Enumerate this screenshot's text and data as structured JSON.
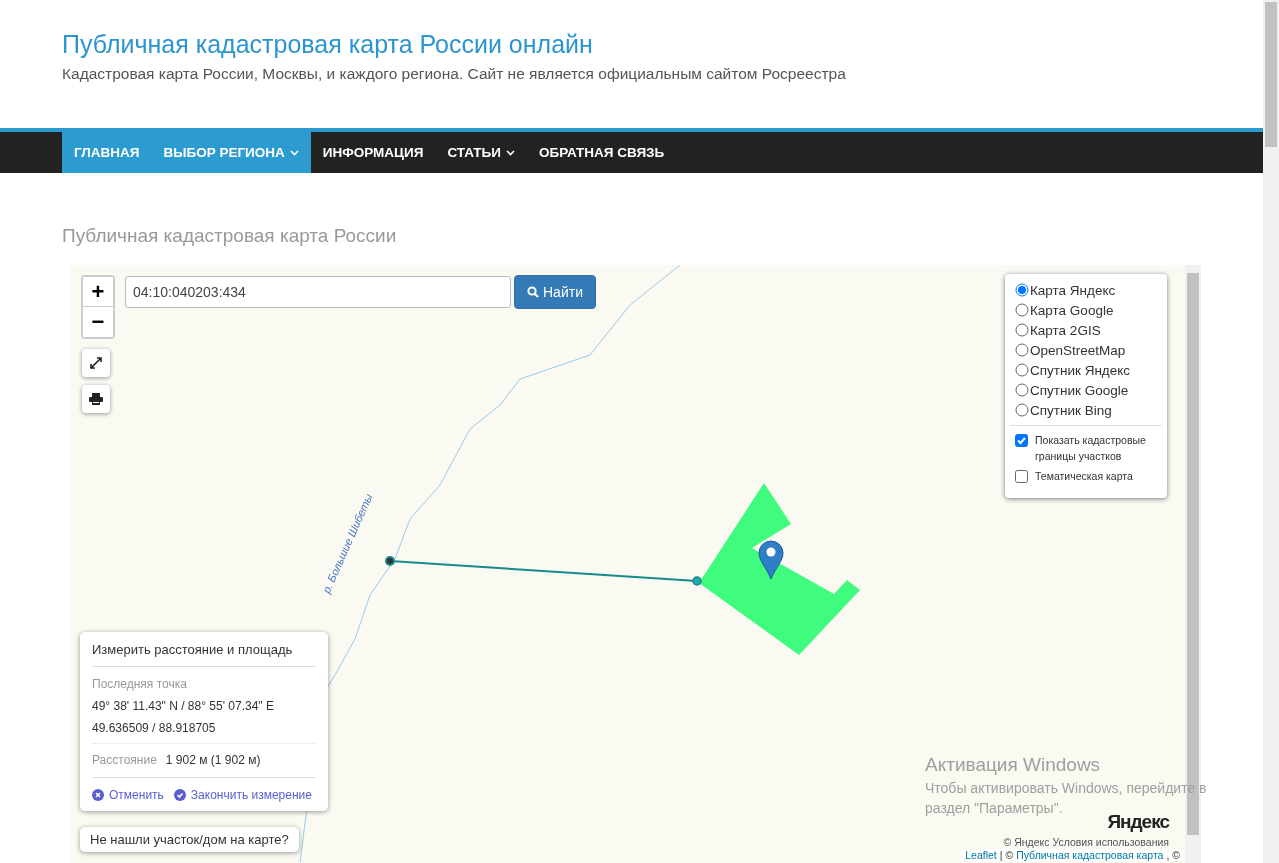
{
  "site": {
    "title": "Публичная кадастровая карта России онлайн",
    "subtitle": "Кадастровая карта России, Москвы, и каждого региона. Сайт не является официальным сайтом Росреестра"
  },
  "nav": [
    {
      "label": "ГЛАВНАЯ",
      "selected": true,
      "dropdown": false
    },
    {
      "label": "ВЫБОР РЕГИОНА",
      "selected": true,
      "dropdown": true
    },
    {
      "label": "ИНФОРМАЦИЯ",
      "selected": false,
      "dropdown": false
    },
    {
      "label": "СТАТЬИ",
      "selected": false,
      "dropdown": true
    },
    {
      "label": "ОБРАТНАЯ СВЯЗЬ",
      "selected": false,
      "dropdown": false
    }
  ],
  "page_heading": "Публичная кадастровая карта России",
  "map": {
    "zoom_in": "+",
    "zoom_out": "−",
    "search": {
      "value": "04:10:040203:434",
      "button": "Найти"
    },
    "layers": [
      {
        "label": "Карта Яндекс",
        "selected": true
      },
      {
        "label": "Карта Google",
        "selected": false
      },
      {
        "label": "Карта 2GIS",
        "selected": false
      },
      {
        "label": "OpenStreetMap",
        "selected": false
      },
      {
        "label": "Спутник Яндекс",
        "selected": false
      },
      {
        "label": "Спутник Google",
        "selected": false
      },
      {
        "label": "Спутник Bing",
        "selected": false
      }
    ],
    "overlays": [
      {
        "label": "Показать кадастровые границы участков",
        "checked": true
      },
      {
        "label": "Тематическая карта",
        "checked": false
      }
    ],
    "river_label": "р. Большие Шибеты",
    "measure": {
      "title": "Измерить расстояние и площадь",
      "last_point_label": "Последняя точка",
      "dms": "49° 38' 11.43\" N / 88° 55' 07.34\" E",
      "decimal": "49.636509 / 88.918705",
      "distance_label": "Расстояние",
      "distance_value": "1 902 м (1 902 м)",
      "cancel": "Отменить",
      "finish": "Закончить измерение"
    },
    "not_found": "Не нашли участок/дом на карте?",
    "logo": "Яндекс",
    "terms": "© Яндекс  Условия использования",
    "attribution": {
      "leaflet": "Leaflet",
      "separator": "| ©",
      "site_link": "Публичная кадастровая карта",
      "tail": ", ©"
    }
  },
  "os_notice": {
    "title": "Активация Windows",
    "text": "Чтобы активировать Windows, перейдите в раздел \"Параметры\"."
  }
}
